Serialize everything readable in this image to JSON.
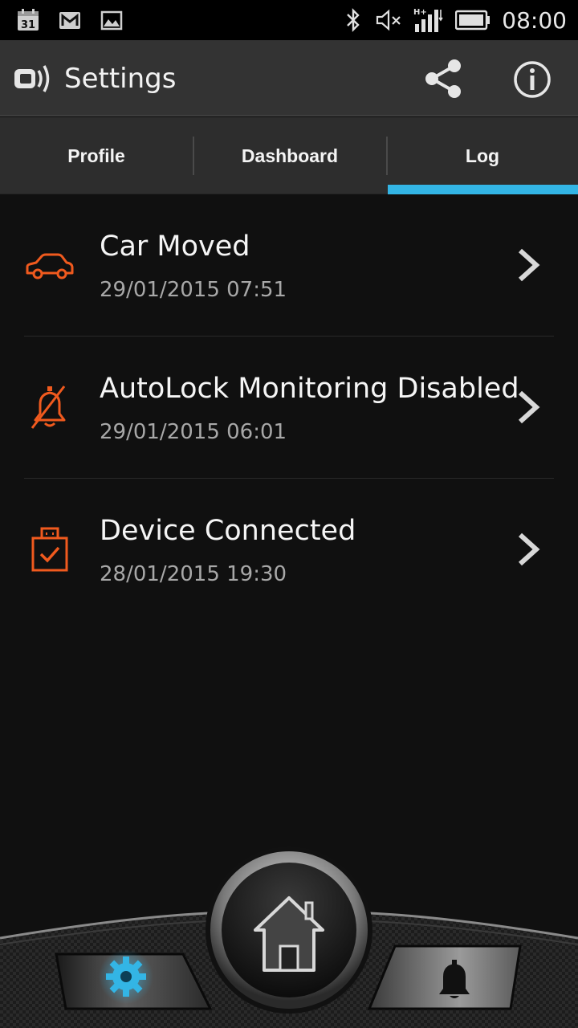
{
  "status_bar": {
    "icons": [
      "calendar-icon",
      "gmail-icon",
      "gallery-icon",
      "bluetooth-icon",
      "mute-icon",
      "signal-icon",
      "battery-icon"
    ],
    "calendar_day": "31",
    "time": "08:00"
  },
  "action_bar": {
    "title": "Settings",
    "icons": [
      "app-logo-icon",
      "share-icon",
      "info-icon"
    ]
  },
  "tabs": [
    {
      "label": "Profile",
      "selected": false
    },
    {
      "label": "Dashboard",
      "selected": false
    },
    {
      "label": "Log",
      "selected": true
    }
  ],
  "log": [
    {
      "icon": "car-icon",
      "title": "Car Moved",
      "time": "29/01/2015 07:51"
    },
    {
      "icon": "alarm-off-icon",
      "title": "AutoLock Monitoring Disabled",
      "time": "29/01/2015 06:01"
    },
    {
      "icon": "device-connected-icon",
      "title": "Device Connected",
      "time": "28/01/2015 19:30"
    }
  ],
  "dock": {
    "icons": [
      "gear-icon",
      "home-icon",
      "bell-icon"
    ]
  },
  "colors": {
    "accent": "#33b5e5",
    "log_icon": "#f05a1e",
    "action_bar": "#333333",
    "tab_bar": "#2d2d2d",
    "background": "#101010"
  }
}
